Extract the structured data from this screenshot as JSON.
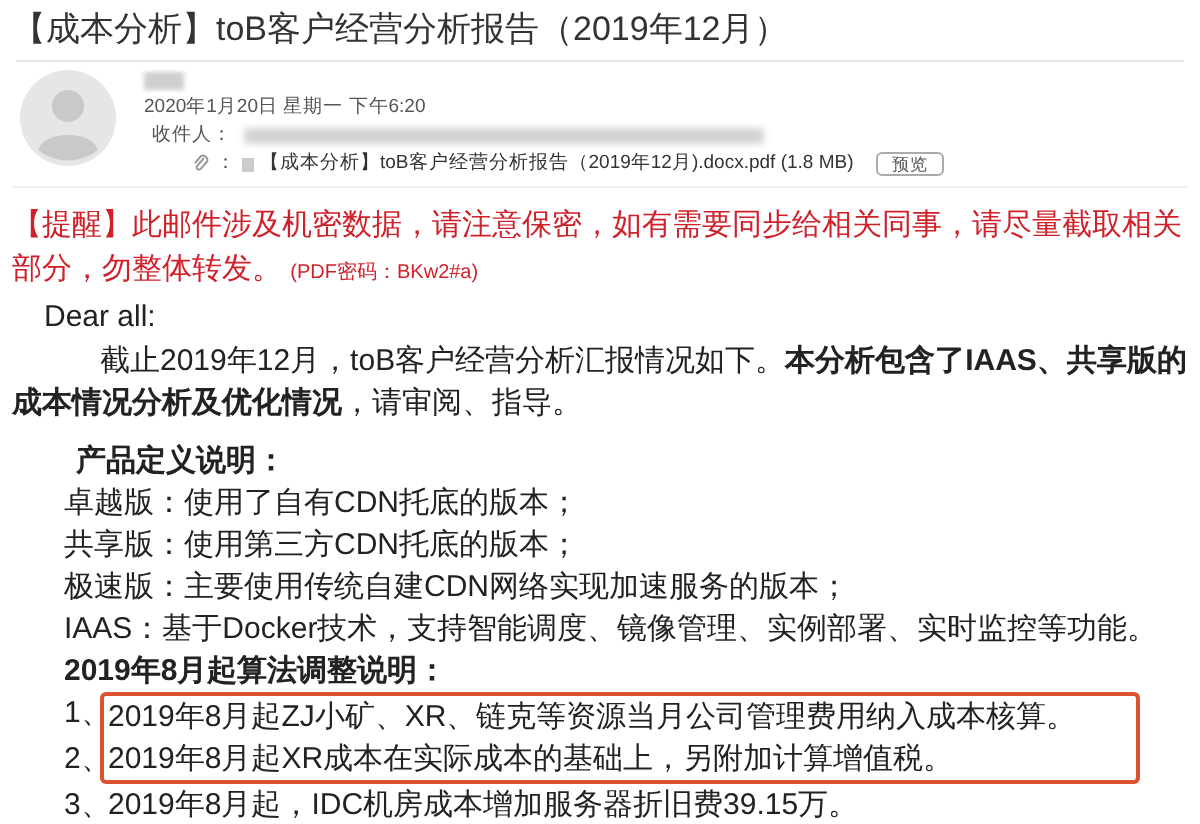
{
  "subject": "【成本分析】toB客户经营分析报告（2019年12月）",
  "header": {
    "date": "2020年1月20日 星期一 下午6:20",
    "recipients_label": "收件人：",
    "attachment_separator": "：",
    "attachment_name": "【成本分析】toB客户经营分析报告（2019年12月).docx.pdf (1.8 MB)",
    "preview_button": "预览"
  },
  "warning": {
    "tag": "【提醒】",
    "text": "此邮件涉及机密数据，请注意保密，如有需要同步给相关同事，请尽量截取相关部分，勿整体转发。",
    "password": "(PDF密码：BKw2#a)"
  },
  "greeting": "Dear all:",
  "intro": "截止2019年12月，toB客户经营分析汇报情况如下。**本分析包含了IAAS、共享版的成本情况分析及优化情况**，请审阅、指导。",
  "definitions_title": "产品定义说明：",
  "definitions": [
    "卓越版：使用了自有CDN托底的版本；",
    "共享版：使用第三方CDN托底的版本；",
    "极速版：主要使用传统自建CDN网络实现加速服务的版本；",
    "IAAS：基于Docker技术，支持智能调度、镜像管理、实例部署、实时监控等功能。"
  ],
  "changes_title": "2019年8月起算法调整说明：",
  "changes": [
    {
      "number": "1、",
      "text": "2019年8月起ZJ小矿、XR、链克等资源当月公司管理费用纳入成本核算。",
      "highlighted": true
    },
    {
      "number": "2、",
      "text": "2019年8月起XR成本在实际成本的基础上，另附加计算增值税。",
      "highlighted": true
    },
    {
      "number": "3、",
      "text": "2019年8月起，IDC机房成本增加服务器折旧费39.15万。",
      "highlighted": false
    }
  ]
}
